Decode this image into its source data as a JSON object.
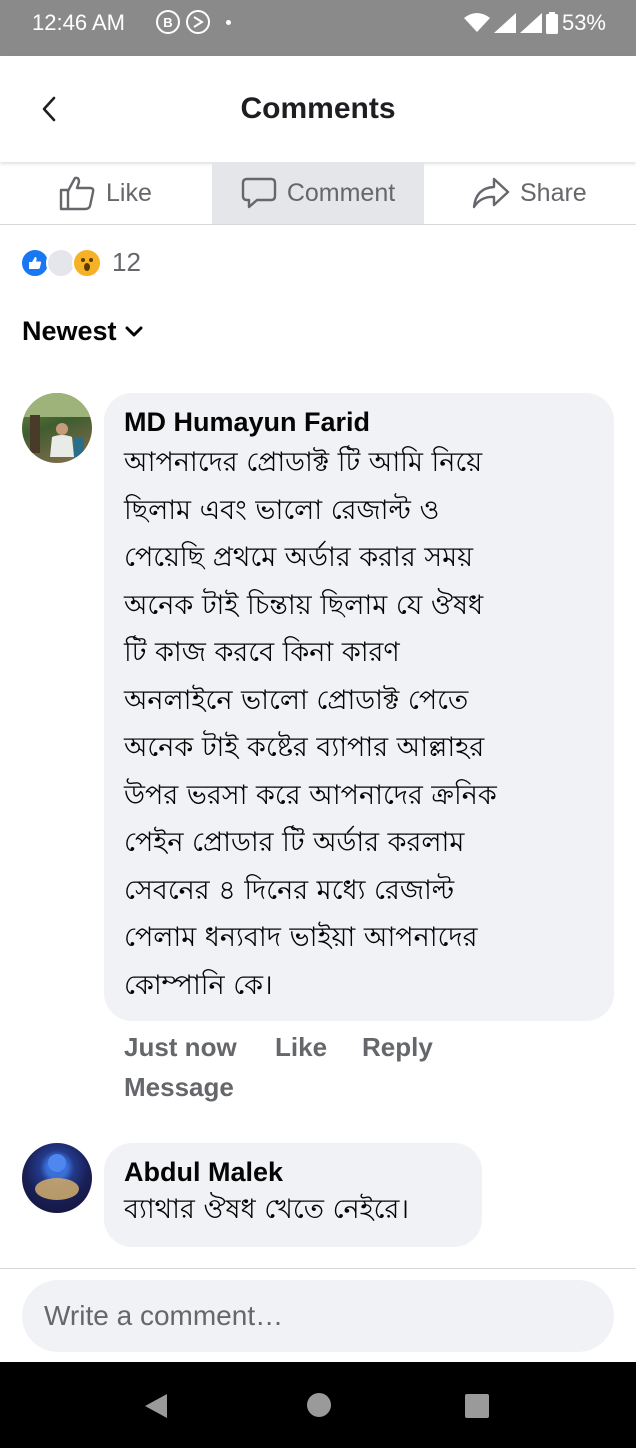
{
  "status_bar": {
    "time": "12:46 AM",
    "battery": "53%"
  },
  "header": {
    "title": "Comments"
  },
  "actions": {
    "like": "Like",
    "comment": "Comment",
    "share": "Share"
  },
  "reactions": {
    "count": "12"
  },
  "sort": {
    "label": "Newest"
  },
  "comments": [
    {
      "author": "MD Humayun Farid",
      "text": "আপনাদের প্রোডাক্ট টি আমি নিয়ে\nছিলাম এবং ভালো রেজাল্ট ও\nপেয়েছি প্রথমে অর্ডার করার সময়\nঅনেক টাই চিন্তায় ছিলাম যে ঔষধ\nটি কাজ করবে কিনা কারণ\nঅনলাইনে ভালো প্রোডাক্ট পেতে\nঅনেক টাই কষ্টের ব্যাপার আল্লাহর\nউপর ভরসা করে আপনাদের ক্রনিক\nপেইন প্রোডার টি অর্ডার করলাম\nসেবনের ৪ দিনের মধ্যে রেজাল্ট\nপেলাম ধন্যবাদ ভাইয়া আপনাদের\nকোম্পানি কে।",
      "time": "Just now",
      "like": "Like",
      "reply": "Reply",
      "message": "Message"
    },
    {
      "author": "Abdul Malek",
      "text": "ব্যাথার ঔষধ খেতে নেইরে।"
    }
  ],
  "composer": {
    "placeholder": "Write a comment…"
  },
  "icons": {
    "back": "back-arrow-icon",
    "like": "thumbs-up-icon",
    "comment": "speech-bubble-icon",
    "share": "share-arrow-icon",
    "sort": "chevron-down-icon"
  },
  "colors": {
    "accent": "#1877f2",
    "bubble": "#f0f2f5",
    "secondary_text": "#65676b",
    "status_bar": "#8a8a8a",
    "nav_bar": "#000000"
  }
}
